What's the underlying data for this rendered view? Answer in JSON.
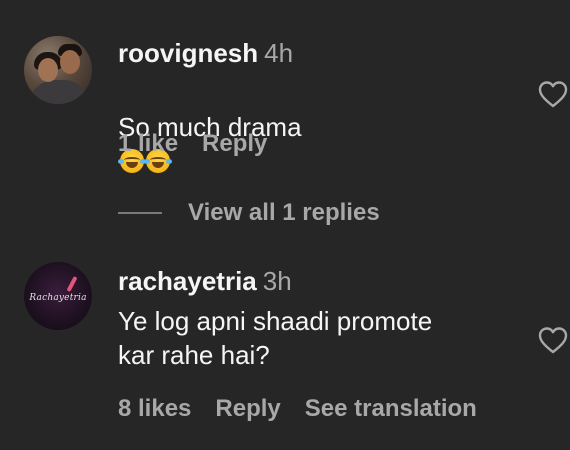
{
  "comments": [
    {
      "username": "roovignesh",
      "time": "4h",
      "text": "So much drama",
      "emoji_icon": "face-with-tears-of-joy-icon",
      "emoji_count": 2,
      "likes_label": "1 like",
      "reply_label": "Reply"
    },
    {
      "username": "rachayetria",
      "time": "3h",
      "text": "Ye log apni shaadi promote\nkar rahe hai?",
      "likes_label": "8 likes",
      "reply_label": "Reply",
      "translate_label": "See translation"
    }
  ],
  "view_replies_label": "View all 1 replies",
  "avatar_logo_text": "Rachayetria",
  "colors": {
    "background": "#262626",
    "primary_text": "#f5f5f5",
    "secondary_text": "#a8a8a8",
    "heart_outline": "#a8a8a8"
  },
  "icons": {
    "like": "heart-outline-icon"
  }
}
